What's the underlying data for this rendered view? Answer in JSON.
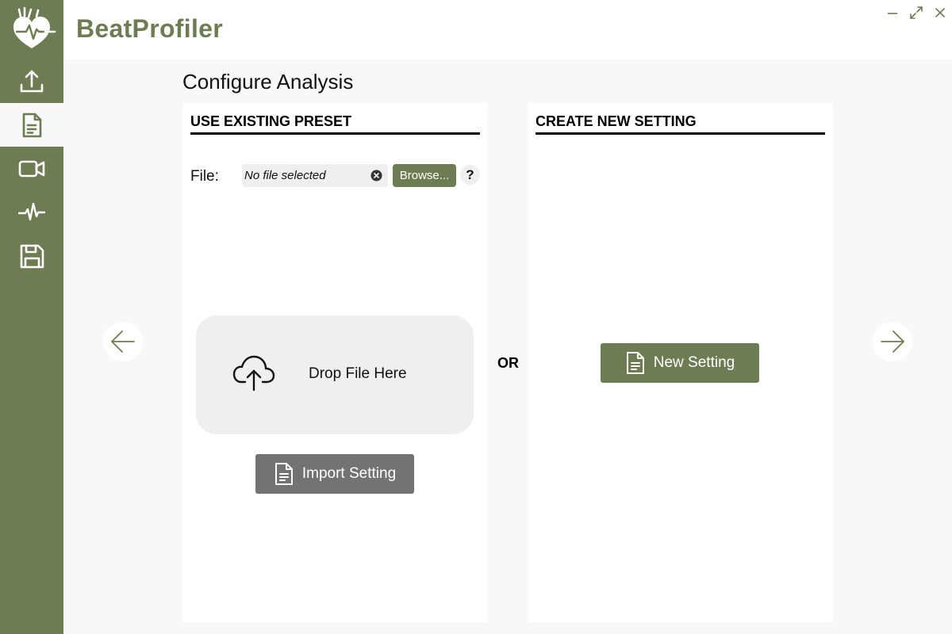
{
  "app": {
    "title": "BeatProfiler"
  },
  "colors": {
    "brand": "#6d7c52",
    "import_button": "#737373",
    "surface": "#efefef"
  },
  "sidebar": {
    "items": [
      {
        "name": "upload",
        "icon": "upload-icon",
        "active": false
      },
      {
        "name": "configure",
        "icon": "document-icon",
        "active": true
      },
      {
        "name": "video",
        "icon": "video-camera-icon",
        "active": false
      },
      {
        "name": "signal",
        "icon": "heartbeat-signal-icon",
        "active": false
      },
      {
        "name": "save",
        "icon": "save-icon",
        "active": false
      }
    ]
  },
  "page": {
    "title": "Configure Analysis"
  },
  "left_panel": {
    "heading": "USE EXISTING PRESET",
    "file_label": "File:",
    "file_value": "No file selected",
    "browse_label": "Browse...",
    "help_label": "?",
    "dropzone_text": "Drop File Here",
    "import_label": "Import Setting"
  },
  "divider": {
    "or_label": "OR"
  },
  "right_panel": {
    "heading": "CREATE NEW SETTING",
    "new_label": "New Setting"
  }
}
